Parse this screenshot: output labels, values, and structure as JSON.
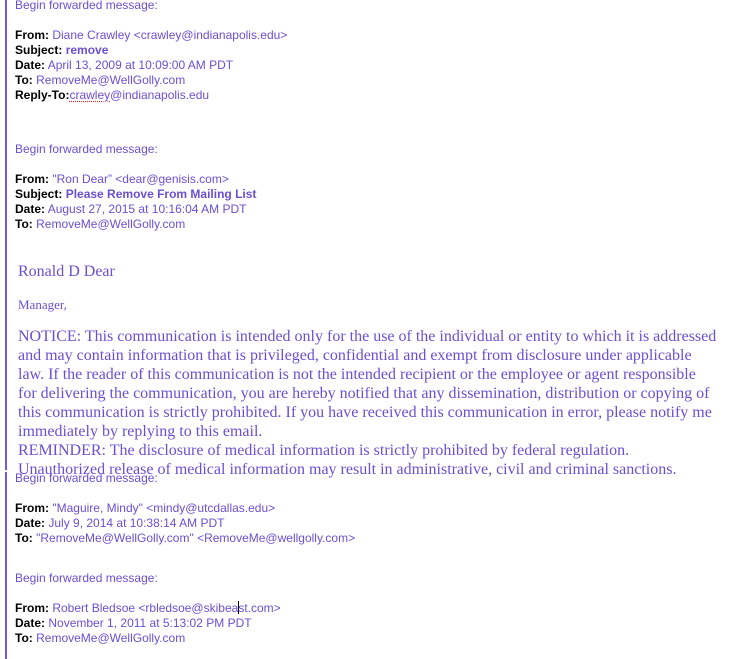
{
  "messages": [
    {
      "begin_label": "Begin forwarded message:",
      "from_label": "From:",
      "from_value": "Diane Crawley <crawley@indianapolis.edu>",
      "subject_label": "Subject:",
      "subject_value": "remove",
      "date_label": "Date:",
      "date_value": "April 13, 2009 at 10:09:00 AM PDT",
      "to_label": "To:",
      "to_value": "RemoveMe@WellGolly.com",
      "reply_to_label": "Reply-To:",
      "reply_to_misspelled": "crawley",
      "reply_to_rest": "@indianapolis.edu"
    },
    {
      "begin_label": "Begin forwarded message:",
      "from_label": "From:",
      "from_value": "\"Ron Dear” <dear@genisis.com>",
      "subject_label": "Subject:",
      "subject_value": "Please Remove From Mailing List",
      "date_label": "Date:",
      "date_value": "August 27, 2015 at 10:16:04 AM PDT",
      "to_label": "To:",
      "to_value": "RemoveMe@WellGolly.com",
      "signature_name": "Ronald D Dear",
      "signature_title": "Manager,",
      "notice_lines": [
        "NOTICE:  This communication is intended only for the use of the individual or entity to which it is addressed",
        "and may contain information that is privileged, confidential and exempt from disclosure under applicable",
        "law.  If the reader of this communication is not the intended recipient or the employee or agent responsible",
        "for delivering the communication, you are hereby notified that any dissemination, distribution or copying of",
        "this communication is strictly prohibited.  If you have received this communication in error, please notify me",
        "immediately by replying to this email.",
        "REMINDER:  The disclosure of medical information is strictly prohibited by federal regulation.",
        "Unauthorized release of medical information may result in administrative, civil and criminal sanctions."
      ]
    },
    {
      "begin_label": "Begin forwarded message:",
      "from_label": "From:",
      "from_value": "\"Maguire, Mindy\" <mindy@utcdallas.edu>",
      "date_label": "Date:",
      "date_value": "July 9, 2014 at 10:38:14 AM PDT",
      "to_label": "To:",
      "to_value": "\"RemoveMe@WellGolly.com\" <RemoveMe@wellgolly.com>"
    },
    {
      "begin_label": "Begin forwarded message:",
      "from_label": "From:",
      "from_value_before_cursor": "Robert Bledsoe <rbledsoe@skibea",
      "from_value_after_cursor": "st.com>",
      "date_label": "Date:",
      "date_value": "November 1, 2011 at 5:13:02 PM PDT",
      "to_label": "To:",
      "to_value": "RemoveMe@WellGolly.com"
    }
  ]
}
